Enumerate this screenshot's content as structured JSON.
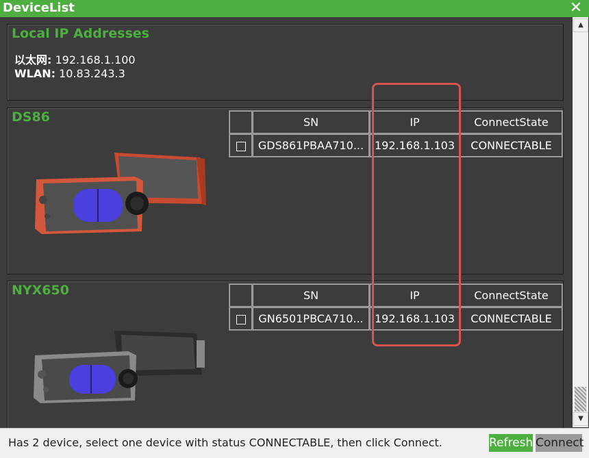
{
  "window": {
    "title": "DeviceList",
    "close_glyph": "✕"
  },
  "local_ip": {
    "title": "Local IP Addresses",
    "entries": [
      {
        "label": "以太网:",
        "value": "192.168.1.100"
      },
      {
        "label": "WLAN:",
        "value": "10.83.243.3"
      }
    ]
  },
  "devices": [
    {
      "name": "DS86",
      "columns": [
        "",
        "SN",
        "IP",
        "ConnectState"
      ],
      "rows": [
        {
          "sn": "GDS861PBAA710...",
          "ip": "192.168.1.103",
          "state": "CONNECTABLE"
        }
      ]
    },
    {
      "name": "NYX650",
      "columns": [
        "",
        "SN",
        "IP",
        "ConnectState"
      ],
      "rows": [
        {
          "sn": "GN6501PBCA710...",
          "ip": "192.168.1.103",
          "state": "CONNECTABLE"
        }
      ]
    }
  ],
  "status": {
    "message": "Has 2 device, select one device with status CONNECTABLE, then click Connect.",
    "refresh_label": "Refresh",
    "connect_label": "Connect"
  },
  "colors": {
    "accent": "#4caf3f",
    "highlight": "#d9534f",
    "background": "#3c3c3c"
  },
  "icons": [
    "close-icon",
    "scroll-up-icon",
    "scroll-down-icon",
    "checkbox-icon"
  ]
}
